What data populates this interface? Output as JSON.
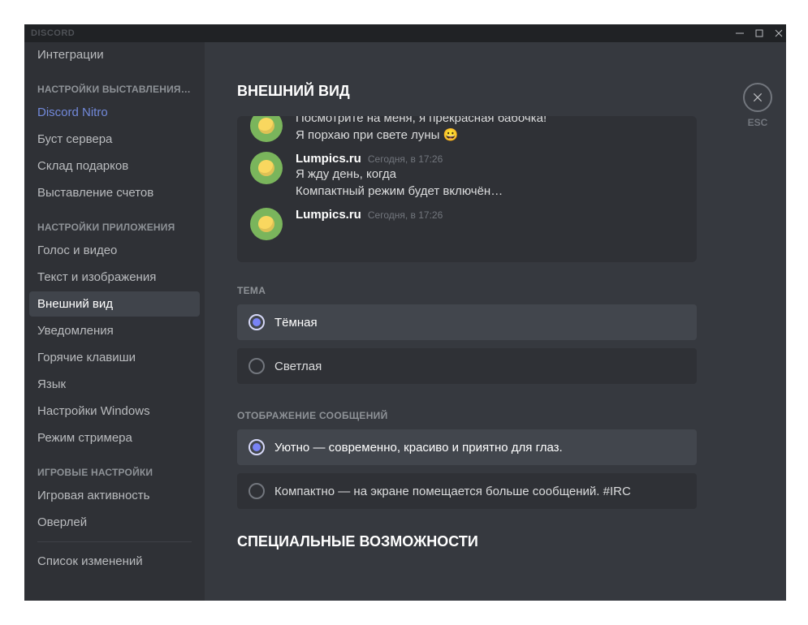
{
  "titlebar": {
    "brand": "DISCORD"
  },
  "sidebar": {
    "item_integrations": "Интеграции",
    "header_billing": "НАСТРОЙКИ ВЫСТАВЛЕНИЯ…",
    "item_nitro": "Discord Nitro",
    "item_boost": "Буст сервера",
    "item_gifts": "Склад подарков",
    "item_billing": "Выставление счетов",
    "header_app": "НАСТРОЙКИ ПРИЛОЖЕНИЯ",
    "item_voice": "Голос и видео",
    "item_text": "Текст и изображения",
    "item_appearance": "Внешний вид",
    "item_notif": "Уведомления",
    "item_hotkeys": "Горячие клавиши",
    "item_lang": "Язык",
    "item_windows": "Настройки Windows",
    "item_streamer": "Режим стримера",
    "header_game": "ИГРОВЫЕ НАСТРОЙКИ",
    "item_activity": "Игровая активность",
    "item_overlay": "Оверлей",
    "item_changelog": "Список изменений"
  },
  "page": {
    "title": "ВНЕШНИЙ ВИД",
    "close_label": "ESC"
  },
  "preview": {
    "msg1_line1": "Посмотрите на меня, я прекрасная бабочка!",
    "msg1_line2": "Я порхаю при свете луны 😀",
    "msg2_user": "Lumpics.ru",
    "msg2_time": "Сегодня, в 17:26",
    "msg2_line1": "Я жду день, когда",
    "msg2_line2": "Компактный режим будет включён…",
    "msg3_user": "Lumpics.ru",
    "msg3_time": "Сегодня, в 17:26"
  },
  "theme": {
    "label": "ТЕМА",
    "option_dark": "Тёмная",
    "option_light": "Светлая"
  },
  "display": {
    "label": "ОТОБРАЖЕНИЕ СООБЩЕНИЙ",
    "option_cozy": "Уютно — современно, красиво и приятно для глаз.",
    "option_compact": "Компактно — на экране помещается больше сообщений. #IRC"
  },
  "accessibility_cutoff": "СПЕЦИАЛЬНЫЕ ВОЗМОЖНОСТИ"
}
